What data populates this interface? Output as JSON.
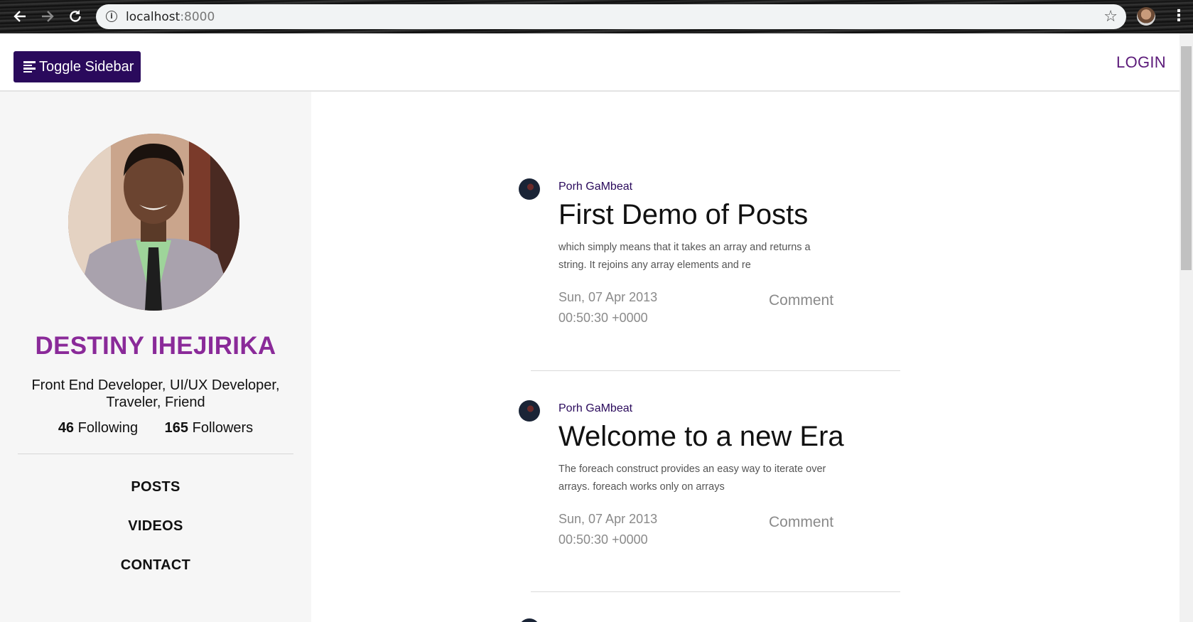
{
  "browser": {
    "url_host": "localhost",
    "url_port": ":8000",
    "back_icon": "arrow-left-icon",
    "forward_icon": "arrow-right-icon",
    "reload_icon": "reload-icon",
    "info_icon": "info-icon",
    "star_icon": "star-icon",
    "menu_icon": "more-vert-icon"
  },
  "topbar": {
    "toggle_label": "Toggle Sidebar",
    "login_label": "LOGIN",
    "brand_color": "#2a0a5c",
    "login_color": "#5c1b7a"
  },
  "sidebar": {
    "name": "DESTINY IHEJIRIKA",
    "bio": "Front End Developer, UI/UX Developer, Traveler, Friend",
    "following_count": "46",
    "following_label": "Following",
    "followers_count": "165",
    "followers_label": "Followers",
    "nav": [
      {
        "label": "POSTS"
      },
      {
        "label": "VIDEOS"
      },
      {
        "label": "CONTACT"
      }
    ],
    "name_color": "#8a2a99"
  },
  "posts": [
    {
      "author": "Porh GaMbeat",
      "title": "First Demo of Posts",
      "excerpt": "which simply means that it takes an array and returns a string. It rejoins any array elements and re",
      "date": "Sun, 07 Apr 2013 00:50:30 +0000",
      "comment": "Comment"
    },
    {
      "author": "Porh GaMbeat",
      "title": "Welcome to a new Era",
      "excerpt": "The foreach construct provides an easy way to iterate over arrays. foreach works only on arrays",
      "date": "Sun, 07 Apr 2013 00:50:30 +0000",
      "comment": "Comment"
    }
  ]
}
